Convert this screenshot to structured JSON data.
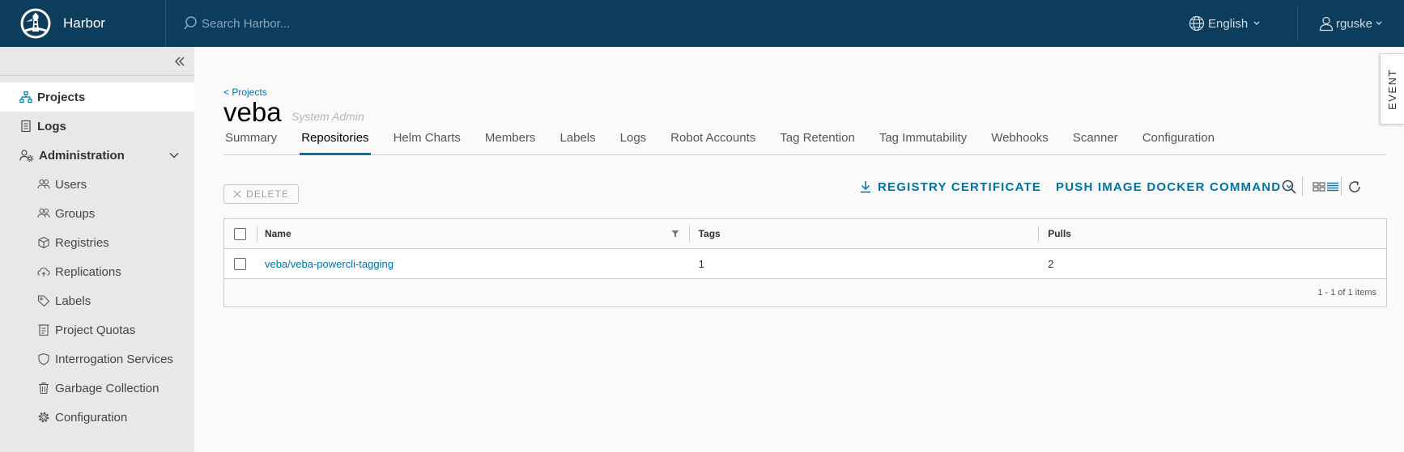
{
  "header": {
    "app_name": "Harbor",
    "search_placeholder": "Search Harbor...",
    "language": "English",
    "username": "rguske"
  },
  "sidebar": {
    "items": [
      {
        "label": "Projects",
        "icon": "projects-icon",
        "active": true
      },
      {
        "label": "Logs",
        "icon": "logs-icon"
      },
      {
        "label": "Administration",
        "icon": "administration-icon",
        "expanded": true
      },
      {
        "label": "Users",
        "icon": "users-icon"
      },
      {
        "label": "Groups",
        "icon": "groups-icon"
      },
      {
        "label": "Registries",
        "icon": "registries-icon"
      },
      {
        "label": "Replications",
        "icon": "replications-icon"
      },
      {
        "label": "Labels",
        "icon": "labels-icon"
      },
      {
        "label": "Project Quotas",
        "icon": "project-quotas-icon"
      },
      {
        "label": "Interrogation Services",
        "icon": "interrogation-services-icon"
      },
      {
        "label": "Garbage Collection",
        "icon": "garbage-collection-icon"
      },
      {
        "label": "Configuration",
        "icon": "configuration-icon"
      }
    ]
  },
  "project": {
    "back_link": "< Projects",
    "name": "veba",
    "role": "System Admin"
  },
  "tabs": [
    {
      "label": "Summary"
    },
    {
      "label": "Repositories",
      "active": true
    },
    {
      "label": "Helm Charts"
    },
    {
      "label": "Members"
    },
    {
      "label": "Labels"
    },
    {
      "label": "Logs"
    },
    {
      "label": "Robot Accounts"
    },
    {
      "label": "Tag Retention"
    },
    {
      "label": "Tag Immutability"
    },
    {
      "label": "Webhooks"
    },
    {
      "label": "Scanner"
    },
    {
      "label": "Configuration"
    }
  ],
  "toolbar": {
    "delete_label": "DELETE",
    "registry_certificate_label": "REGISTRY CERTIFICATE",
    "push_command_label": "PUSH IMAGE DOCKER COMMAND"
  },
  "table": {
    "columns": [
      "Name",
      "Tags",
      "Pulls"
    ],
    "rows": [
      {
        "name": "veba/veba-powercli-tagging",
        "tags": "1",
        "pulls": "2"
      }
    ],
    "footer": "1 - 1 of 1 items"
  },
  "event_tab": "EVENT",
  "colors": {
    "header_bg": "#0c3d5c",
    "accent": "#0072a3",
    "sidebar_bg": "#e8e8e8"
  }
}
